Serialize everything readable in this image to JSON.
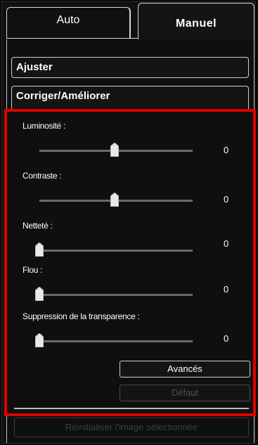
{
  "tabs": {
    "auto_label": "Auto",
    "manuel_label": "Manuel",
    "active": "Manuel"
  },
  "sections": {
    "ajuster_label": "Ajuster",
    "corriger_label": "Corriger/Améliorer"
  },
  "sliders": [
    {
      "label": "Luminosité :",
      "value": "0",
      "position": 0.5
    },
    {
      "label": "Contraste :",
      "value": "0",
      "position": 0.5
    },
    {
      "label": "Netteté :",
      "value": "0",
      "position": 0.0
    },
    {
      "label": "Flou :",
      "value": "0",
      "position": 0.0
    },
    {
      "label": "Suppression de la transparence :",
      "value": "0",
      "position": 0.0
    }
  ],
  "buttons": {
    "avances_label": "Avancés",
    "defaut_label": "Défaut",
    "defaut_enabled": false,
    "reset_label": "Réinitialiser l'image sélectionnée",
    "reset_enabled": false
  },
  "colors": {
    "highlight": "#e00000",
    "background": "#0f0f0f",
    "text": "#ffffff",
    "disabled_text": "#4d4d4d"
  }
}
